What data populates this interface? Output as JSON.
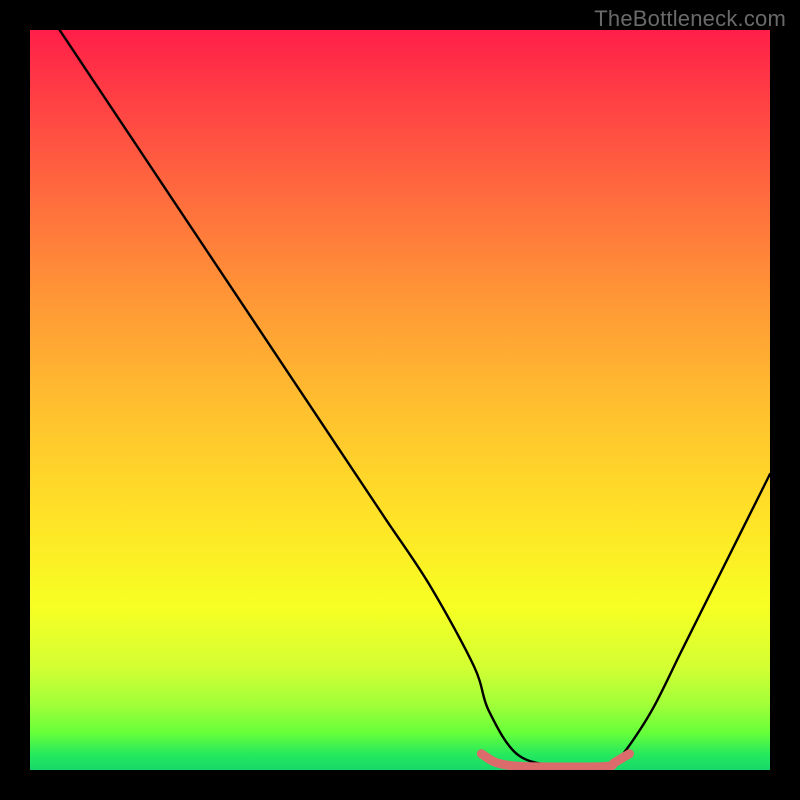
{
  "watermark": "TheBottleneck.com",
  "chart_data": {
    "type": "line",
    "title": "",
    "xlabel": "",
    "ylabel": "",
    "xlim": [
      0,
      100
    ],
    "ylim": [
      0,
      100
    ],
    "grid": false,
    "legend": false,
    "annotations": [],
    "series": [
      {
        "name": "curve",
        "color": "#000000",
        "x": [
          4,
          8,
          12,
          18,
          24,
          30,
          36,
          42,
          48,
          54,
          60,
          62,
          66,
          72,
          78,
          80,
          84,
          88,
          92,
          96,
          100
        ],
        "y": [
          100,
          94,
          88,
          79,
          70,
          61,
          52,
          43,
          34,
          25,
          14,
          8,
          2,
          0.5,
          0.5,
          2,
          8,
          16,
          24,
          32,
          40
        ]
      },
      {
        "name": "bottom-highlight",
        "color": "#e06666",
        "x": [
          61,
          63,
          66,
          72,
          78,
          79,
          81
        ],
        "y": [
          2.2,
          1.0,
          0.5,
          0.4,
          0.5,
          1.0,
          2.2
        ]
      }
    ],
    "colors": {
      "gradient_top": "#ff1e49",
      "gradient_mid1": "#ff9636",
      "gradient_mid2": "#ffe327",
      "gradient_bottom": "#17d96a",
      "frame": "#000000",
      "watermark": "#6a6a6a"
    }
  }
}
